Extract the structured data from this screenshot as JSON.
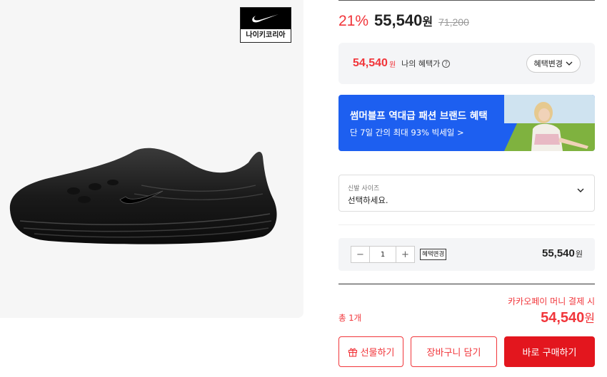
{
  "product": {
    "brand_label": "나이키코리아",
    "image_icon": "clog-shoe-image"
  },
  "price": {
    "discount": "21%",
    "sale": "55,540",
    "won": "원",
    "original": "71,200"
  },
  "benefit": {
    "price": "54,540",
    "won": "원",
    "label": "나의 혜택가",
    "info_icon": "ⓘ",
    "change_label": "혜택변경"
  },
  "banner": {
    "title": "썸머블프 역대급 패션 브랜드 혜택",
    "subtitle": "단 7일 간의 최대 93% 빅세일 >"
  },
  "size_select": {
    "label": "신발 사이즈",
    "value": "선택하세요."
  },
  "quantity": {
    "minus": "−",
    "value": "1",
    "plus": "+",
    "change_label": "혜택변경",
    "price": "55,540",
    "won": "원"
  },
  "total": {
    "kakao_label": "카카오페이 머니 결제 시",
    "count": "총 1개",
    "price": "54,540",
    "won": "원"
  },
  "buttons": {
    "gift": "선물하기",
    "cart": "장바구니 담기",
    "buy": "바로 구매하기"
  },
  "colors": {
    "accent": "#f1353a",
    "buy_button": "#e3161e",
    "banner_blue": "#1d5ff0"
  }
}
